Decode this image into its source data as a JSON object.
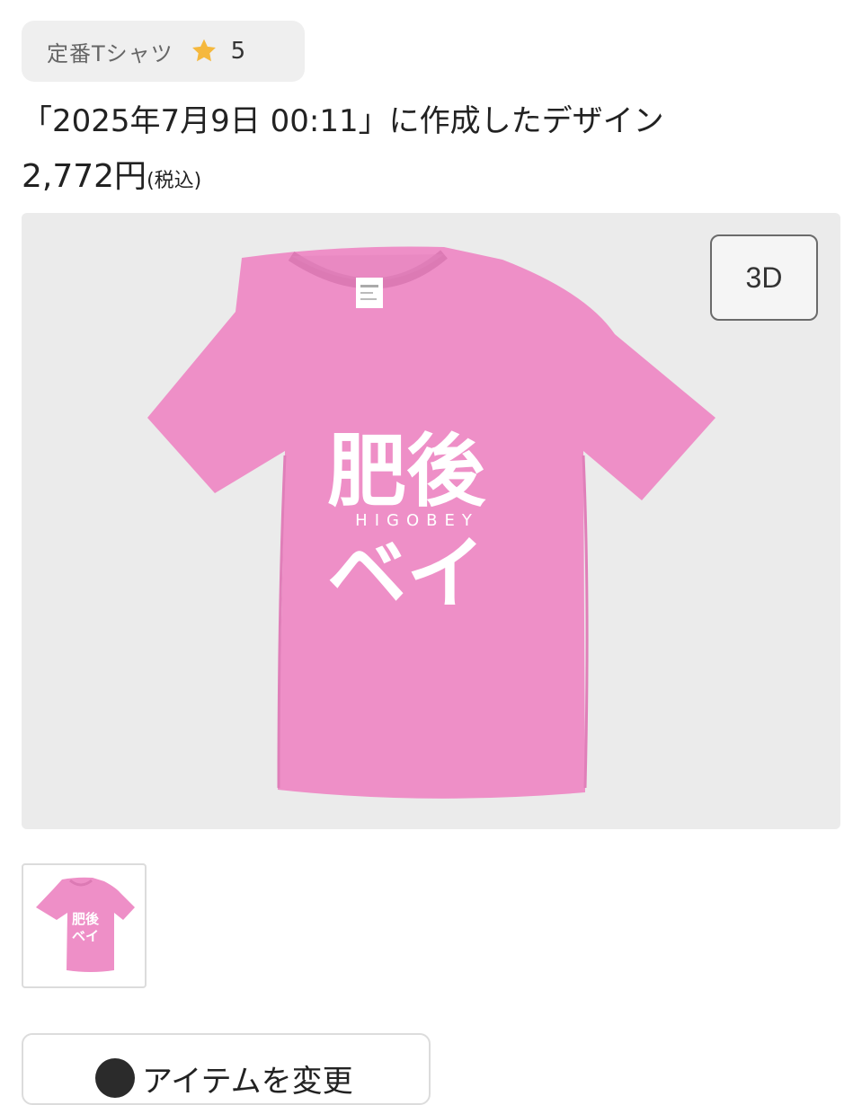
{
  "category_badge": {
    "label": "定番Tシャツ",
    "rating": "5"
  },
  "product": {
    "title": "「2025年7月9日 00:11」に作成したデザイン",
    "price": "2,772円",
    "tax_note": "(税込)"
  },
  "preview": {
    "view_3d_label": "3D",
    "shirt_color": "#ee8fc7",
    "design": {
      "line1": "肥後",
      "subtitle": "HIGOBEY",
      "line2": "ベイ"
    }
  },
  "actions": {
    "change_item_label": "アイテムを変更"
  },
  "icons": {
    "star": "star-icon",
    "change": "change-item-icon"
  },
  "colors": {
    "star": "#f5b83d",
    "badge_bg": "#efefef",
    "preview_bg": "#ebebeb"
  }
}
